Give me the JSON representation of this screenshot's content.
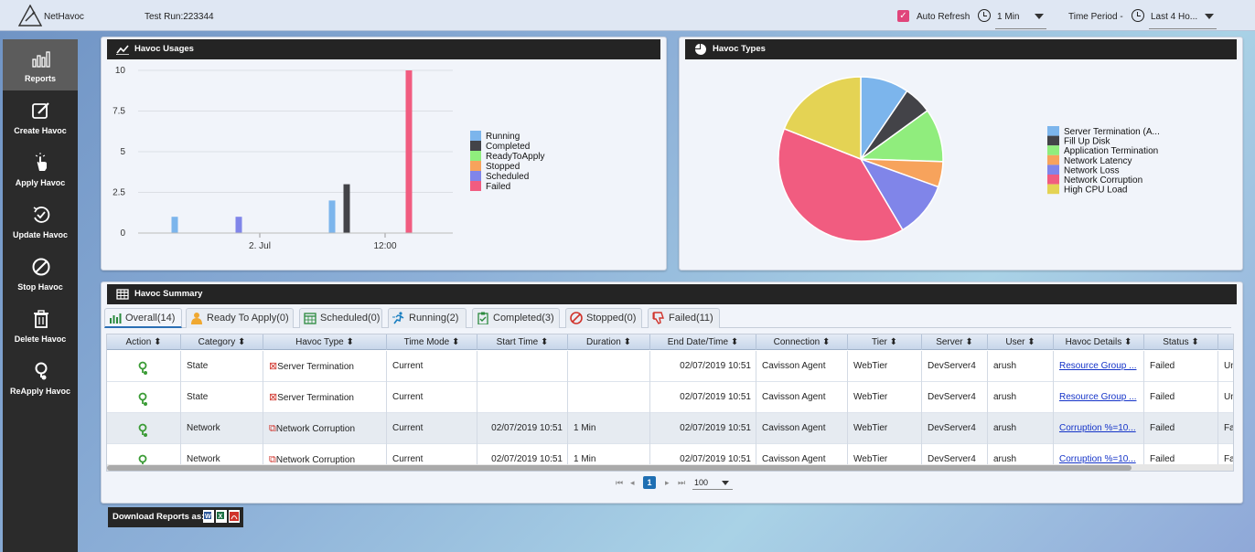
{
  "app": {
    "name": "NetHavoc",
    "test_run": "Test Run:223344"
  },
  "topbar": {
    "auto_refresh_label": "Auto Refresh",
    "auto_refresh_checked": true,
    "refresh_interval": "1 Min",
    "time_period_label": "Time Period -",
    "time_period_value": "Last 4 Ho..."
  },
  "sidebar": {
    "items": [
      {
        "label": "Reports",
        "icon": "bar-chart-icon",
        "active": true
      },
      {
        "label": "Create Havoc",
        "icon": "edit-icon"
      },
      {
        "label": "Apply Havoc",
        "icon": "pointer-hand-icon"
      },
      {
        "label": "Update Havoc",
        "icon": "update-check-icon"
      },
      {
        "label": "Stop Havoc",
        "icon": "stop-circle-icon"
      },
      {
        "label": "Delete Havoc",
        "icon": "trash-icon"
      },
      {
        "label": "ReApply Havoc",
        "icon": "reapply-icon"
      }
    ]
  },
  "usage_panel": {
    "title": "Havoc Usages"
  },
  "types_panel": {
    "title": "Havoc Types"
  },
  "summary_panel": {
    "title": "Havoc Summary"
  },
  "colors": {
    "Running": "#7cb5ec",
    "Completed": "#434348",
    "ReadyToApply": "#90ed7d",
    "Stopped": "#f7a35c",
    "Scheduled": "#8085e9",
    "Failed": "#f15c80",
    "pie": [
      "#7cb5ec",
      "#434348",
      "#90ed7d",
      "#f7a35c",
      "#8085e9",
      "#f15c80",
      "#e4d354"
    ],
    "accent_checkbox": "#e0457b",
    "link": "#1433c8"
  },
  "chart_data": [
    {
      "type": "bar",
      "title": "Havoc Usages",
      "y_ticks": [
        "10",
        "7.5",
        "5",
        "2.5",
        "0"
      ],
      "x_ticks": [
        "2. Jul",
        "12:00"
      ],
      "ylim": [
        0,
        10
      ],
      "legend_position": "right",
      "series": [
        {
          "name": "Running",
          "values": [
            1,
            0,
            2,
            0
          ]
        },
        {
          "name": "Completed",
          "values": [
            0,
            0,
            3,
            0
          ]
        },
        {
          "name": "ReadyToApply",
          "values": [
            0,
            0,
            0,
            0
          ]
        },
        {
          "name": "Stopped",
          "values": [
            0,
            0,
            0,
            0
          ]
        },
        {
          "name": "Scheduled",
          "values": [
            0,
            1,
            0,
            0
          ]
        },
        {
          "name": "Failed",
          "values": [
            0,
            0,
            0,
            10
          ]
        }
      ]
    },
    {
      "type": "pie",
      "title": "Havoc Types",
      "legend_position": "right",
      "slices": [
        {
          "name": "Server Termination (A...",
          "value": 9.5
        },
        {
          "name": "Fill Up Disk",
          "value": 5.5
        },
        {
          "name": "Application Termination",
          "value": 10.5
        },
        {
          "name": "Network Latency",
          "value": 5
        },
        {
          "name": "Network Loss",
          "value": 11
        },
        {
          "name": "Network Corruption",
          "value": 39.5
        },
        {
          "name": "High CPU Load",
          "value": 19
        }
      ]
    }
  ],
  "tabs": [
    {
      "label": "Overall(14)",
      "icon": "bar-chart-icon",
      "active": true
    },
    {
      "label": "Ready To Apply(0)",
      "icon": "person-icon"
    },
    {
      "label": "Scheduled(0)",
      "icon": "calendar-icon"
    },
    {
      "label": "Running(2)",
      "icon": "running-icon"
    },
    {
      "label": "Completed(3)",
      "icon": "clipboard-check-icon"
    },
    {
      "label": "Stopped(0)",
      "icon": "ban-icon"
    },
    {
      "label": "Failed(11)",
      "icon": "thumbs-down-icon"
    }
  ],
  "table": {
    "columns": [
      "Action",
      "Category",
      "Havoc Type",
      "Time Mode",
      "Start Time",
      "Duration",
      "End Date/Time",
      "Connection",
      "Tier",
      "Server",
      "User",
      "Havoc Details",
      "Status",
      "C"
    ],
    "rows": [
      {
        "category": "State",
        "havoc_type": "Server Termination",
        "time_mode": "Current",
        "start_time": "",
        "duration": "",
        "end_time": "02/07/2019 10:51",
        "connection": "Cavisson Agent",
        "tier": "WebTier",
        "server": "DevServer4",
        "user": "arush",
        "details": "Resource Group ...",
        "status": "Failed",
        "extra": "Un"
      },
      {
        "category": "State",
        "havoc_type": "Server Termination",
        "time_mode": "Current",
        "start_time": "",
        "duration": "",
        "end_time": "02/07/2019 10:51",
        "connection": "Cavisson Agent",
        "tier": "WebTier",
        "server": "DevServer4",
        "user": "arush",
        "details": "Resource Group ...",
        "status": "Failed",
        "extra": "Un"
      },
      {
        "category": "Network",
        "havoc_type": "Network Corruption",
        "time_mode": "Current",
        "start_time": "02/07/2019 10:51",
        "duration": "1 Min",
        "end_time": "02/07/2019 10:51",
        "connection": "Cavisson Agent",
        "tier": "WebTier",
        "server": "DevServer4",
        "user": "arush",
        "details": "Corruption %=10...",
        "status": "Failed",
        "extra": "Fa"
      },
      {
        "category": "Network",
        "havoc_type": "Network Corruption",
        "time_mode": "Current",
        "start_time": "02/07/2019 10:51",
        "duration": "1 Min",
        "end_time": "02/07/2019 10:51",
        "connection": "Cavisson Agent",
        "tier": "WebTier",
        "server": "DevServer4",
        "user": "arush",
        "details": "Corruption %=10...",
        "status": "Failed",
        "extra": "Fa"
      }
    ]
  },
  "pager": {
    "current_page": "1",
    "page_size": "100"
  },
  "download": {
    "label": "Download Reports as:",
    "formats": [
      "word",
      "excel",
      "pdf"
    ]
  }
}
